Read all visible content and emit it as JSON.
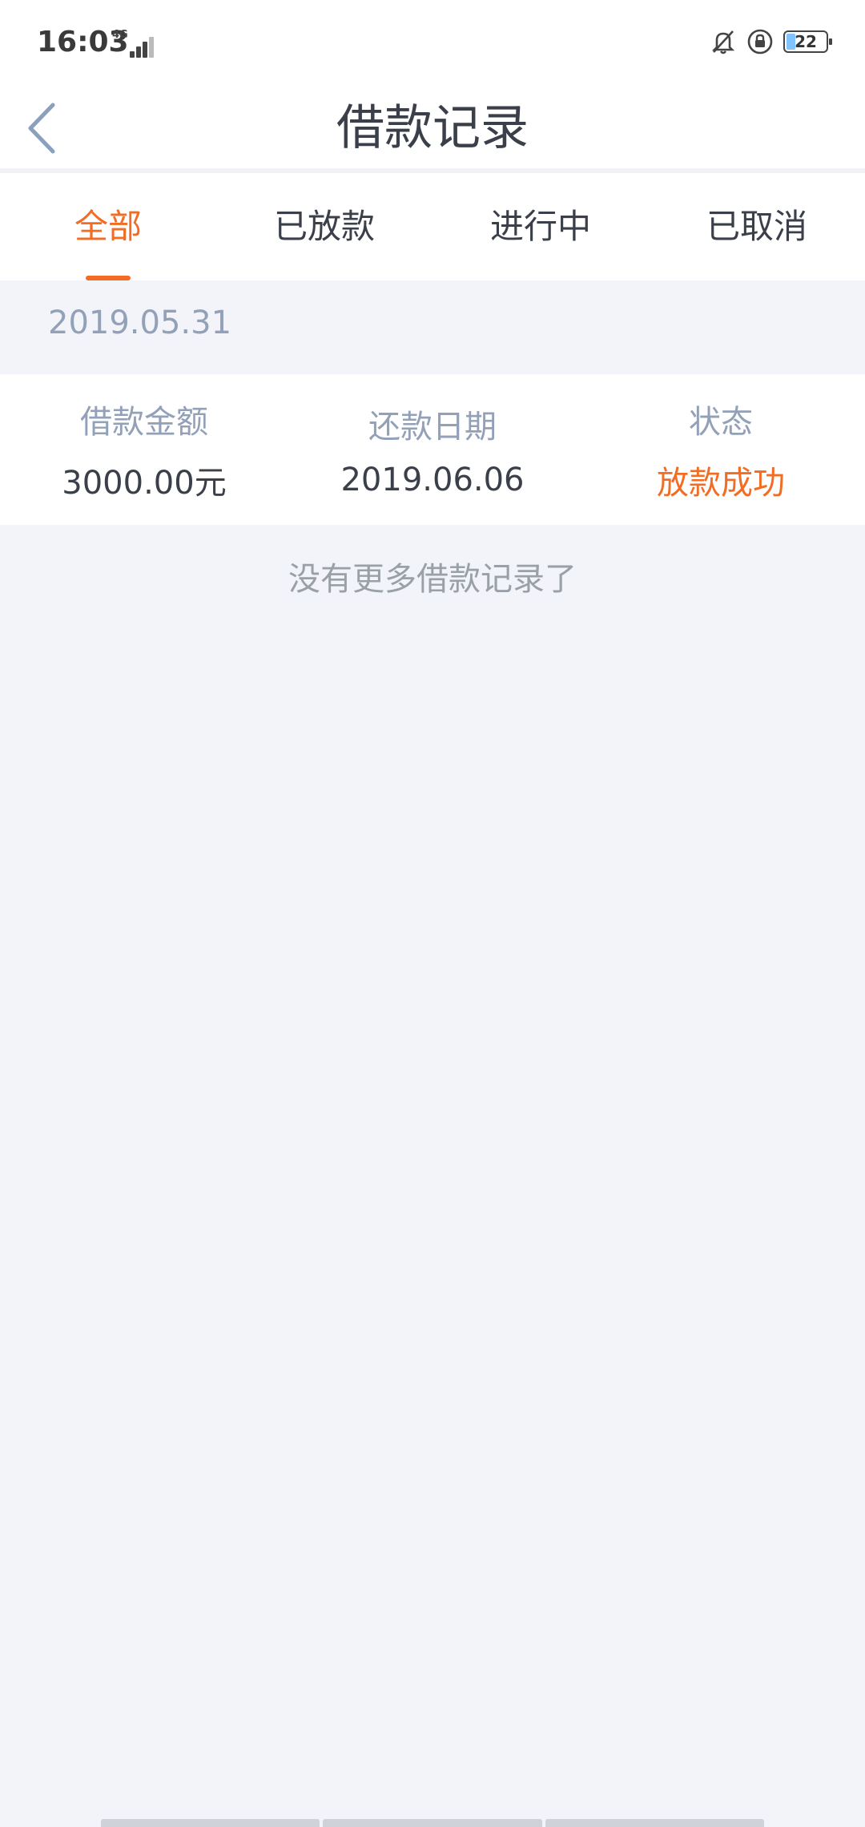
{
  "status_bar": {
    "time": "16:03",
    "network": "4G",
    "battery": "22"
  },
  "nav": {
    "title": "借款记录"
  },
  "tabs": [
    {
      "label": "全部",
      "active": true
    },
    {
      "label": "已放款",
      "active": false
    },
    {
      "label": "进行中",
      "active": false
    },
    {
      "label": "已取消",
      "active": false
    }
  ],
  "records": [
    {
      "date": "2019.05.31",
      "columns": [
        {
          "label": "借款金额",
          "value": "3000.00元"
        },
        {
          "label": "还款日期",
          "value": "2019.06.06"
        },
        {
          "label": "状态",
          "value": "放款成功"
        }
      ]
    }
  ],
  "footer": {
    "no_more_text": "没有更多借款记录了"
  },
  "colors": {
    "accent": "#f36c24",
    "label": "#93a1b8",
    "text": "#3a3f4a",
    "background": "#f2f4f9"
  }
}
